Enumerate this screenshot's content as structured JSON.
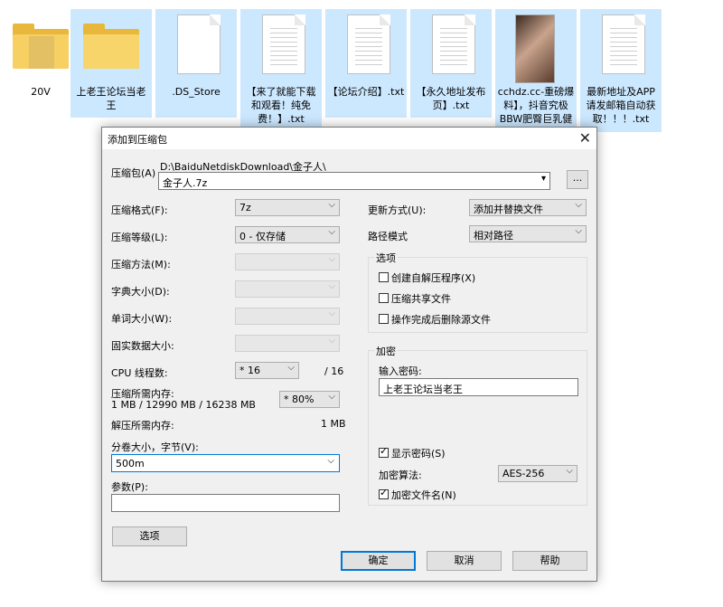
{
  "explorer": {
    "files": [
      {
        "name": "20V",
        "type": "folder"
      },
      {
        "name": "上老王论坛当老王",
        "type": "folder"
      },
      {
        "name": ".DS_Store",
        "type": "file"
      },
      {
        "name": "【来了就能下载和观看！纯免费！】.txt",
        "type": "txt"
      },
      {
        "name": "【论坛介绍】.txt",
        "type": "txt"
      },
      {
        "name": "【永久地址发布页】.txt",
        "type": "txt"
      },
      {
        "name": "cchdz.cc-重磅爆料】，抖音究极BBW肥臀巨乳健",
        "type": "video"
      },
      {
        "name": "最新地址及APP请发邮箱自动获取！！！.txt",
        "type": "txt"
      }
    ]
  },
  "dialog": {
    "title": "添加到压缩包",
    "close": "✕",
    "archive_label": "压缩包(A)",
    "archive_path": "D:\\BaiduNetdiskDownload\\金子人\\",
    "archive_name": "金子人.7z",
    "browse_label": "...",
    "format_label": "压缩格式(F):",
    "format_value": "7z",
    "level_label": "压缩等级(L):",
    "level_value": "0 - 仅存储",
    "method_label": "压缩方法(M):",
    "dict_label": "字典大小(D):",
    "word_label": "单词大小(W):",
    "solid_label": "固实数据大小:",
    "threads_label": "CPU 线程数:",
    "threads_value": "* 16",
    "threads_max": "/ 16",
    "mem_label": "压缩所需内存:",
    "mem_value": "1 MB / 12990 MB / 16238 MB",
    "mem_pct": "* 80%",
    "decomp_label": "解压所需内存:",
    "decomp_value": "1 MB",
    "volume_label": "分卷大小，字节(V):",
    "volume_value": "500m",
    "params_label": "参数(P):",
    "params_value": "",
    "options_button": "选项",
    "update_label": "更新方式(U):",
    "update_value": "添加并替换文件",
    "path_label": "路径模式",
    "path_value": "相对路径",
    "options_group": "选项",
    "opt_sfx": "创建自解压程序(X)",
    "opt_shared": "压缩共享文件",
    "opt_delete": "操作完成后删除源文件",
    "enc_group": "加密",
    "pwd_label": "输入密码:",
    "pwd_value": "上老王论坛当老王",
    "show_pwd": "显示密码(S)",
    "enc_method_label": "加密算法:",
    "enc_method_value": "AES-256",
    "enc_names": "加密文件名(N)",
    "ok": "确定",
    "cancel": "取消",
    "help": "帮助"
  },
  "colors": {
    "accent": "#0078d7",
    "selection": "#cce8ff",
    "dialog_bg": "#f0f0f0"
  }
}
